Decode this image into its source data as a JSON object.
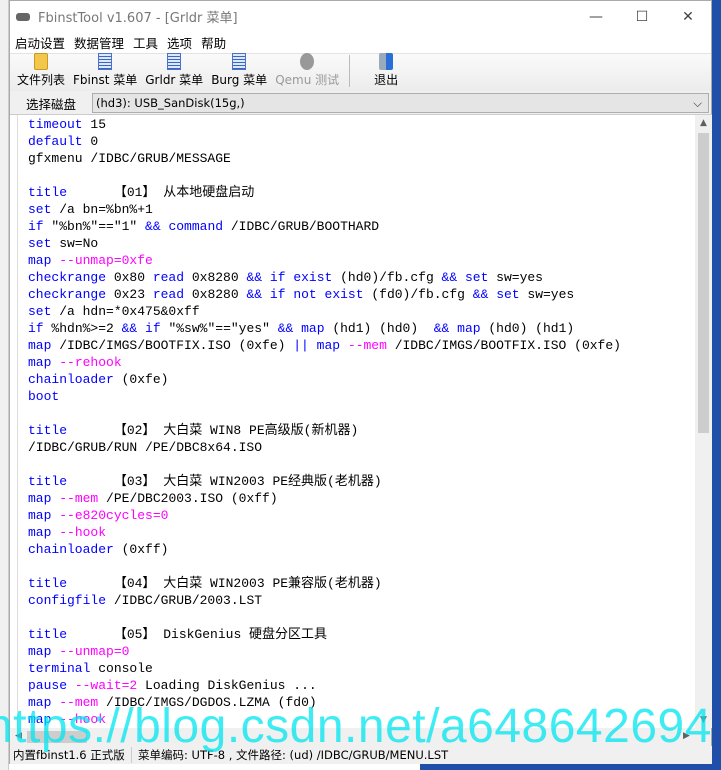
{
  "window": {
    "title": "FbinstTool v1.607 - [Grldr 菜单]",
    "minimize": "—",
    "maximize": "☐",
    "close": "✕"
  },
  "menu": [
    "启动设置",
    "数据管理",
    "工具",
    "选项",
    "帮助"
  ],
  "toolbar": [
    {
      "label": "文件列表",
      "icon": "folder-icon",
      "enabled": true
    },
    {
      "label": "Fbinst 菜单",
      "icon": "document-icon",
      "enabled": true
    },
    {
      "label": "Grldr 菜单",
      "icon": "document-icon",
      "enabled": true
    },
    {
      "label": "Burg 菜单",
      "icon": "document-icon",
      "enabled": true
    },
    {
      "label": "Qemu 测试",
      "icon": "qemu-icon",
      "enabled": false
    },
    {
      "label": "退出",
      "icon": "exit-icon",
      "enabled": true
    }
  ],
  "disk": {
    "label": "选择磁盘",
    "value": "(hd3): USB_SanDisk(15g,)"
  },
  "editor": {
    "lines": [
      [
        [
          "timeout",
          "k"
        ],
        [
          " 15",
          ""
        ]
      ],
      [
        [
          "default",
          "k"
        ],
        [
          " 0",
          ""
        ]
      ],
      [
        [
          "gfxmenu /IDBC/GRUB/MESSAGE",
          ""
        ]
      ],
      [],
      [
        [
          "title",
          "k"
        ],
        [
          "      【01】 从本地硬盘启动",
          ""
        ]
      ],
      [
        [
          "set",
          "k"
        ],
        [
          " /a bn=%bn%+1",
          ""
        ]
      ],
      [
        [
          "if",
          "k"
        ],
        [
          " \"%bn%\"==\"1\" ",
          ""
        ],
        [
          "&&",
          "k"
        ],
        [
          " ",
          ""
        ],
        [
          "command",
          "k"
        ],
        [
          " /IDBC/GRUB/BOOTHARD",
          ""
        ]
      ],
      [
        [
          "set",
          "k"
        ],
        [
          " sw=No",
          ""
        ]
      ],
      [
        [
          "map",
          "k"
        ],
        [
          " ",
          ""
        ],
        [
          "--unmap=0xfe",
          "o"
        ]
      ],
      [
        [
          "checkrange",
          "k"
        ],
        [
          " 0x80 ",
          ""
        ],
        [
          "read",
          "k"
        ],
        [
          " 0x8280 ",
          ""
        ],
        [
          "&&",
          "k"
        ],
        [
          " ",
          ""
        ],
        [
          "if",
          "k"
        ],
        [
          " ",
          ""
        ],
        [
          "exist",
          "k"
        ],
        [
          " (hd0)/fb.cfg ",
          ""
        ],
        [
          "&&",
          "k"
        ],
        [
          " ",
          ""
        ],
        [
          "set",
          "k"
        ],
        [
          " sw=yes",
          ""
        ]
      ],
      [
        [
          "checkrange",
          "k"
        ],
        [
          " 0x23 ",
          ""
        ],
        [
          "read",
          "k"
        ],
        [
          " 0x8280 ",
          ""
        ],
        [
          "&&",
          "k"
        ],
        [
          " ",
          ""
        ],
        [
          "if",
          "k"
        ],
        [
          " ",
          ""
        ],
        [
          "not",
          "k"
        ],
        [
          " ",
          ""
        ],
        [
          "exist",
          "k"
        ],
        [
          " (fd0)/fb.cfg ",
          ""
        ],
        [
          "&&",
          "k"
        ],
        [
          " ",
          ""
        ],
        [
          "set",
          "k"
        ],
        [
          " sw=yes",
          ""
        ]
      ],
      [
        [
          "set",
          "k"
        ],
        [
          " /a hdn=*0x475&0xff",
          ""
        ]
      ],
      [
        [
          "if",
          "k"
        ],
        [
          " %hdn%>=2 ",
          ""
        ],
        [
          "&&",
          "k"
        ],
        [
          " ",
          ""
        ],
        [
          "if",
          "k"
        ],
        [
          " \"%sw%\"==\"yes\" ",
          ""
        ],
        [
          "&&",
          "k"
        ],
        [
          " ",
          ""
        ],
        [
          "map",
          "k"
        ],
        [
          " (hd1) (hd0)  ",
          ""
        ],
        [
          "&&",
          "k"
        ],
        [
          " ",
          ""
        ],
        [
          "map",
          "k"
        ],
        [
          " (hd0) (hd1)",
          ""
        ]
      ],
      [
        [
          "map",
          "k"
        ],
        [
          " /IDBC/IMGS/BOOTFIX.ISO (0xfe) ",
          ""
        ],
        [
          "||",
          "k"
        ],
        [
          " ",
          ""
        ],
        [
          "map",
          "k"
        ],
        [
          " ",
          ""
        ],
        [
          "--mem",
          "o"
        ],
        [
          " /IDBC/IMGS/BOOTFIX.ISO (0xfe)",
          ""
        ]
      ],
      [
        [
          "map",
          "k"
        ],
        [
          " ",
          ""
        ],
        [
          "--rehook",
          "o"
        ]
      ],
      [
        [
          "chainloader",
          "k"
        ],
        [
          " (0xfe)",
          ""
        ]
      ],
      [
        [
          "boot",
          "k"
        ]
      ],
      [],
      [
        [
          "title",
          "k"
        ],
        [
          "      【02】 大白菜 WIN8 PE高级版(新机器)",
          ""
        ]
      ],
      [
        [
          "/IDBC/GRUB/RUN /PE/DBC8x64.ISO",
          ""
        ]
      ],
      [],
      [
        [
          "title",
          "k"
        ],
        [
          "      【03】 大白菜 WIN2003 PE经典版(老机器)",
          ""
        ]
      ],
      [
        [
          "map",
          "k"
        ],
        [
          " ",
          ""
        ],
        [
          "--mem",
          "o"
        ],
        [
          " /PE/DBC2003.ISO (0xff)",
          ""
        ]
      ],
      [
        [
          "map",
          "k"
        ],
        [
          " ",
          ""
        ],
        [
          "--e820cycles=0",
          "o"
        ]
      ],
      [
        [
          "map",
          "k"
        ],
        [
          " ",
          ""
        ],
        [
          "--hook",
          "o"
        ]
      ],
      [
        [
          "chainloader",
          "k"
        ],
        [
          " (0xff)",
          ""
        ]
      ],
      [],
      [
        [
          "title",
          "k"
        ],
        [
          "      【04】 大白菜 WIN2003 PE兼容版(老机器)",
          ""
        ]
      ],
      [
        [
          "configfile",
          "k"
        ],
        [
          " /IDBC/GRUB/2003.LST",
          ""
        ]
      ],
      [],
      [
        [
          "title",
          "k"
        ],
        [
          "      【05】 DiskGenius 硬盘分区工具",
          ""
        ]
      ],
      [
        [
          "map",
          "k"
        ],
        [
          " ",
          ""
        ],
        [
          "--unmap=0",
          "o"
        ]
      ],
      [
        [
          "terminal",
          "k"
        ],
        [
          " console",
          ""
        ]
      ],
      [
        [
          "pause",
          "k"
        ],
        [
          " ",
          ""
        ],
        [
          "--wait=2",
          "o"
        ],
        [
          " Loading DiskGenius ...",
          ""
        ]
      ],
      [
        [
          "map",
          "k"
        ],
        [
          " ",
          ""
        ],
        [
          "--mem",
          "o"
        ],
        [
          " /IDBC/IMGS/DGDOS.LZMA (fd0)",
          ""
        ]
      ],
      [
        [
          "map",
          "k"
        ],
        [
          " ",
          ""
        ],
        [
          "--hook",
          "o"
        ]
      ]
    ]
  },
  "status": {
    "left": "内置fbinst1.6 正式版",
    "right": "菜单编码: UTF-8 , 文件路径: (ud) /IDBC/GRUB/MENU.LST"
  },
  "watermark": "https://blog.csdn.net/a648642694",
  "colors": {
    "keyword": "#0000ff",
    "option": "#ff00ff",
    "watermark": "#00e6f0"
  }
}
